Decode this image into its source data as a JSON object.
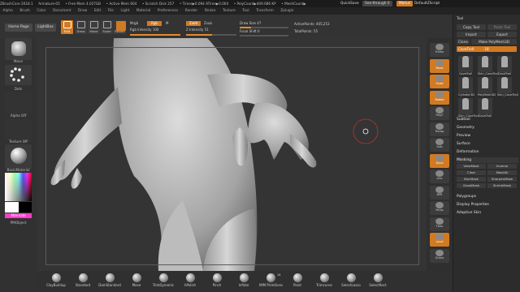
{
  "titlebar": {
    "items": [
      "ZBrushCore 2018.1",
      "Armature-05",
      "• Free Mem 4.027GB",
      "• Active Mem 604",
      "• Scratch Disk 257",
      "• Timer▶0.094 ATime▶0.004",
      "• PolyCount▶409.686 KP",
      "• MeshCount▶"
    ],
    "quicksave": "QuickSave",
    "seethrough": "See-through  0",
    "menus_btn": "Menus",
    "script": "DefaultZScript"
  },
  "menubar": [
    "Alpha",
    "Brush",
    "Color",
    "Document",
    "Draw",
    "Edit",
    "File",
    "Light",
    "Material",
    "Preferences",
    "Render",
    "Stroke",
    "Texture",
    "Tool",
    "Transform",
    "Zplugin"
  ],
  "topshelf": {
    "home_page": "Home Page",
    "lightbox": "LightBox",
    "edit": "Edit",
    "draw": "Draw",
    "move": "Move",
    "scale": "Scale",
    "rotate": "Rotate",
    "mrgb": "Mrgb",
    "rgb": "Rgb",
    "m": "M",
    "rgb_intensity_label": "Rgb Intensity",
    "rgb_intensity_value": "100",
    "rgb_intensity": 1.0,
    "zadd": "Zadd",
    "zsub": "Zsub",
    "z_intensity_label": "Z Intensity",
    "z_intensity_value": "51",
    "z_intensity": 0.51,
    "draw_size_label": "Draw Size",
    "draw_size_value": "47",
    "draw_size": 0.23,
    "focal_shift_label": "Focal Shift",
    "focal_shift_value": "0",
    "active_points": "ActivePoints: 405,253",
    "total_points": "TotalPoints: 55"
  },
  "leftshelf": {
    "move_label": "Move",
    "dots_label": "Dots",
    "alpha_label": "Alpha Off",
    "texture_label": "Texture Off",
    "material_label": "BasicMaterial",
    "alternate": "Alternate",
    "object_label": "PMObject"
  },
  "rightshelf": [
    "Frame",
    "Move",
    "Scale",
    "Rotate",
    "PolyF",
    "Transp",
    "Solo",
    "Dyna",
    "Line",
    "BPR",
    "Persp",
    "Floor",
    "Local",
    "Gizmo"
  ],
  "toolpanel": {
    "title": "Tool",
    "copy_tool": "Copy Tool",
    "paste_tool": "Paste Tool",
    "import": "Import",
    "export": "Export",
    "clone": "Clone",
    "make_polymesh": "Make PolyMesh3D",
    "current_tool_label": "CaveTroll",
    "current_tool_value": "18",
    "thumbs": [
      "CaveTroll",
      "Skin_CaveTroll",
      "CaveTroll",
      "Cylinder3D",
      "PolyMesh3D",
      "Skin_CaveTroll",
      "Skin_CaveTroll",
      "CaveTroll"
    ],
    "subtool": "Subtool",
    "geometry": "Geometry",
    "preview": "Preview",
    "surface": "Surface",
    "deformation": "Deformation",
    "masking": "Masking",
    "mask_buttons": [
      "ViewMask",
      "Inverse",
      "Clear",
      "MaskAll",
      "BlurMask",
      "SharpenMask",
      "GrowMask",
      "ShrinkMask"
    ],
    "polygroups": "Polygroups",
    "display_properties": "Display Properties",
    "adaptive_skin": "Adaptive Skin"
  },
  "bottomshelf": {
    "brushes": [
      "ClayBuildup",
      "Standard",
      "DamStandard",
      "Move",
      "TrimDynamic",
      "hPolish",
      "Pinch",
      "Inflate",
      "IMM Primitives",
      "Paint",
      "Trimcurve",
      "SelectLasso",
      "SelectRect"
    ],
    "imm_badge": "14"
  },
  "colors": {
    "accent": "#e58a2c",
    "active_swatch": "#ff3ac8"
  }
}
